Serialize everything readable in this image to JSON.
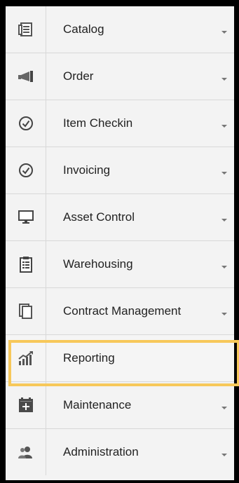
{
  "menu": {
    "items": [
      {
        "label": "Catalog",
        "icon": "catalog-icon",
        "has_dropdown": true
      },
      {
        "label": "Order",
        "icon": "megaphone-icon",
        "has_dropdown": true
      },
      {
        "label": "Item Checkin",
        "icon": "check-circle-icon",
        "has_dropdown": true
      },
      {
        "label": "Invoicing",
        "icon": "check-circle-icon",
        "has_dropdown": true
      },
      {
        "label": "Asset Control",
        "icon": "monitor-icon",
        "has_dropdown": true
      },
      {
        "label": "Warehousing",
        "icon": "clipboard-icon",
        "has_dropdown": true
      },
      {
        "label": "Contract Management",
        "icon": "documents-icon",
        "has_dropdown": true
      },
      {
        "label": "Reporting",
        "icon": "growth-chart-icon",
        "has_dropdown": false
      },
      {
        "label": "Maintenance",
        "icon": "calendar-plus-icon",
        "has_dropdown": true
      },
      {
        "label": "Administration",
        "icon": "users-icon",
        "has_dropdown": true
      }
    ],
    "highlighted_item": "Reporting",
    "highlight_color": "#f7c85a"
  }
}
